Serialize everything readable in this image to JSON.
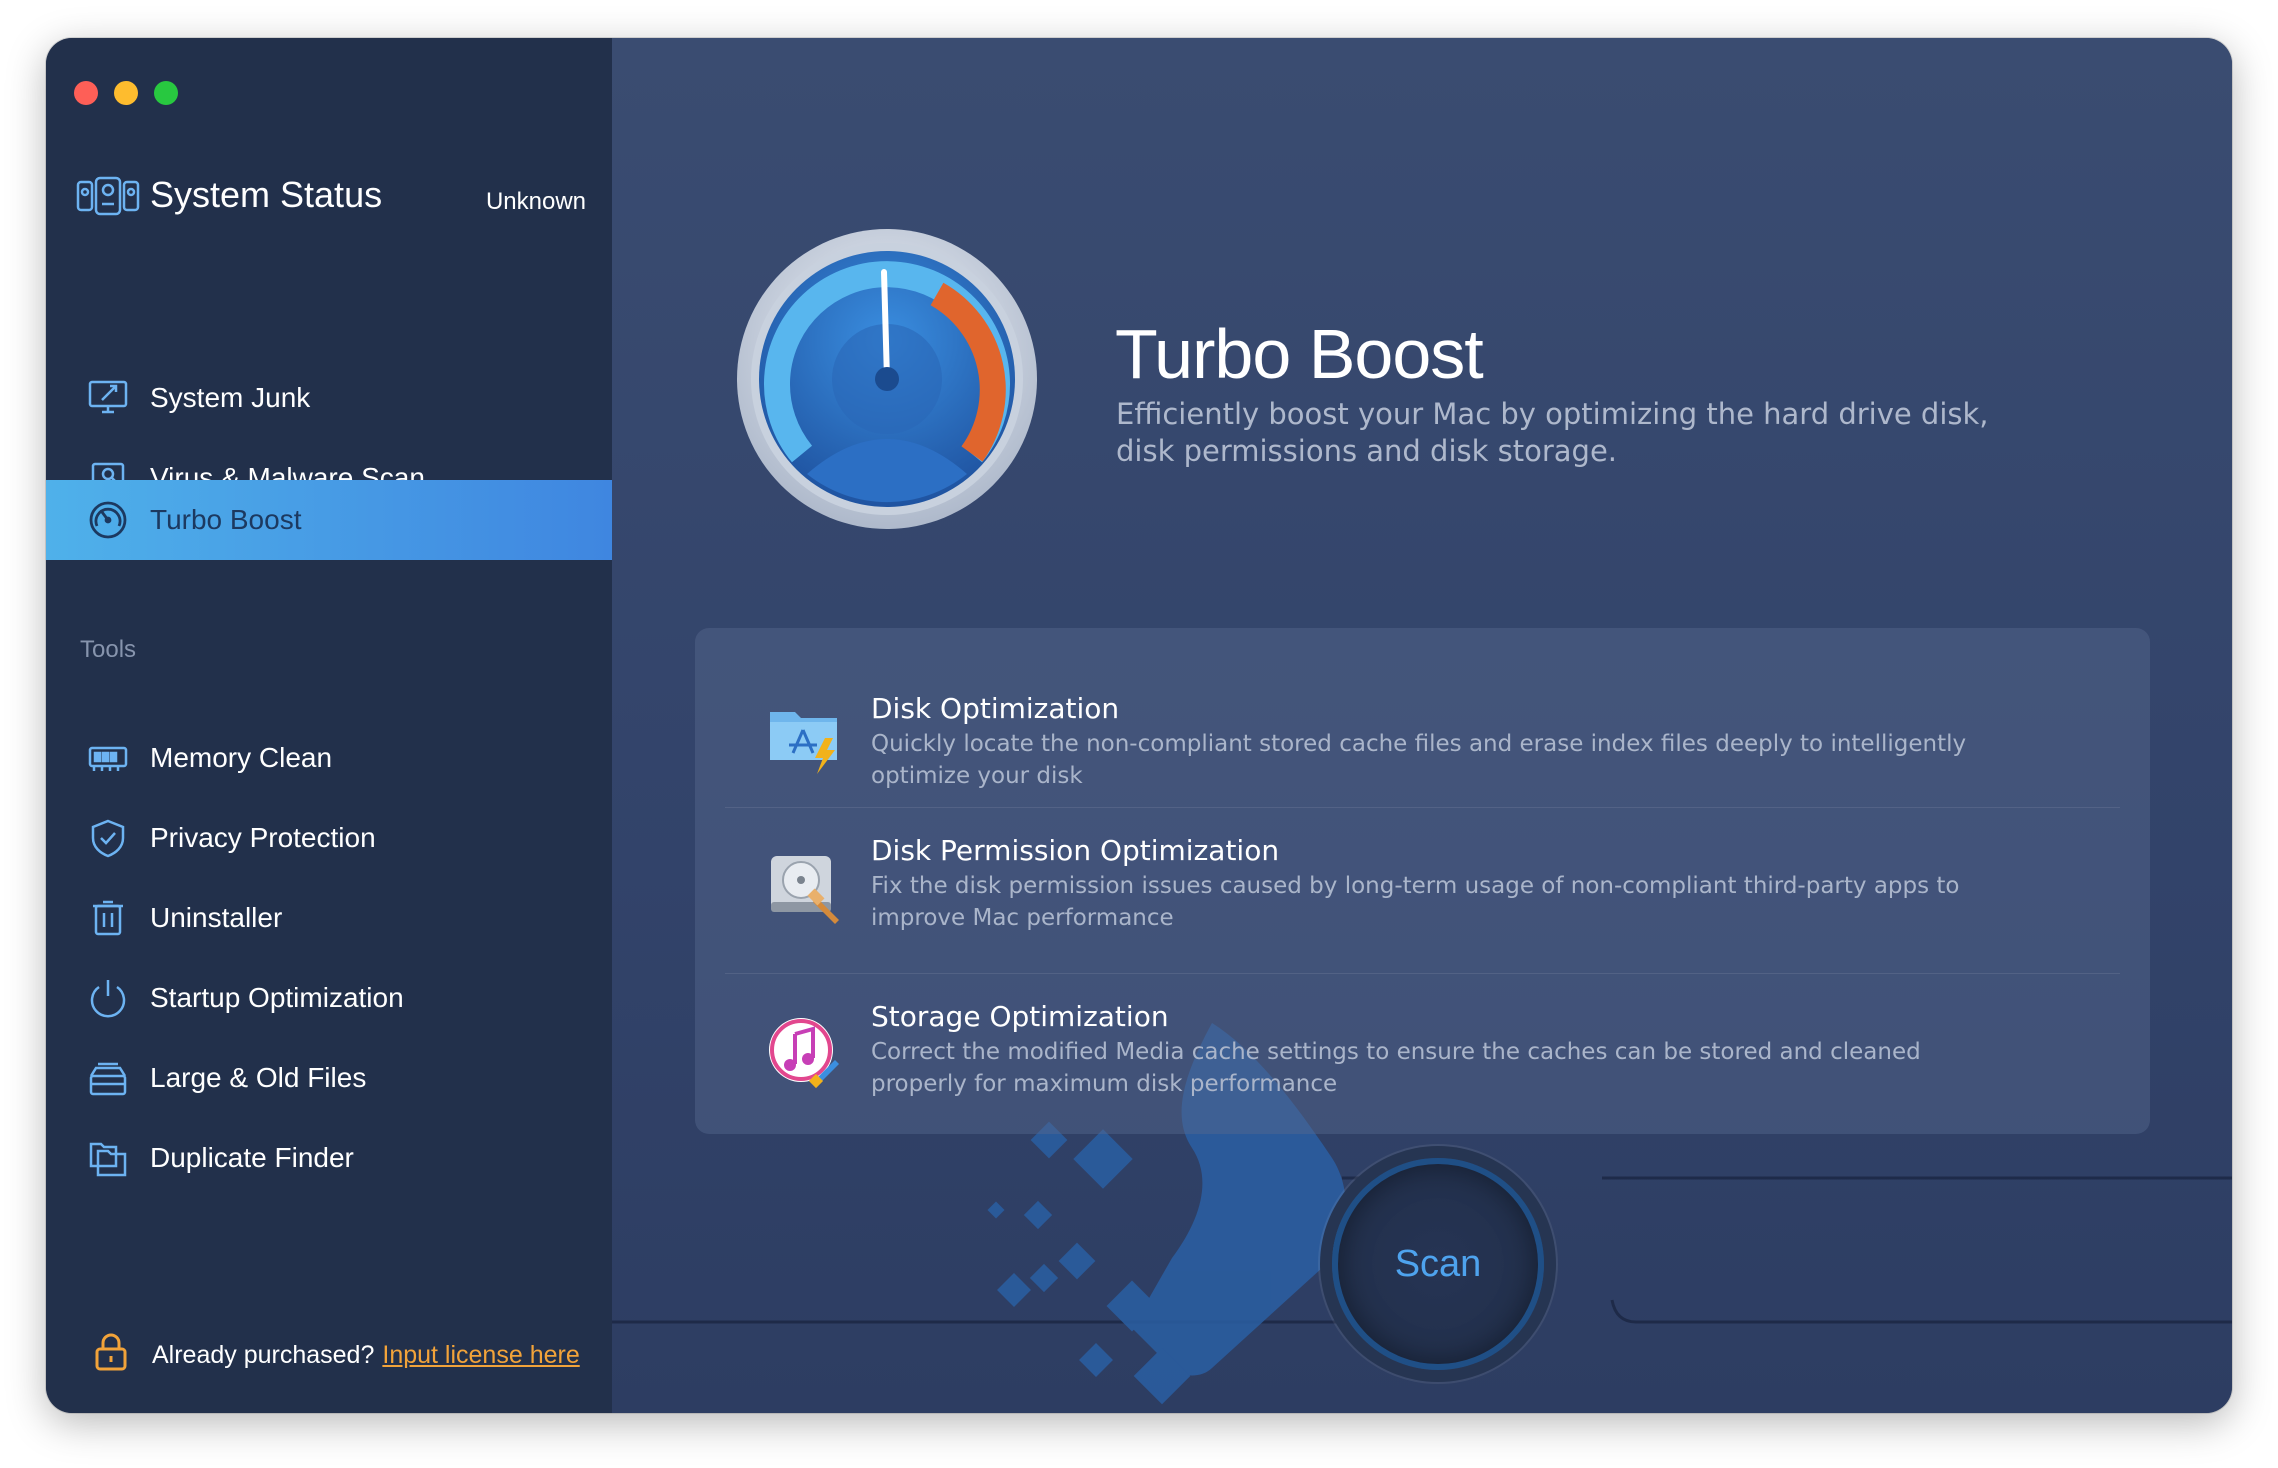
{
  "window": {
    "traffic_lights": [
      "close",
      "minimize",
      "zoom"
    ]
  },
  "sidebar": {
    "status": {
      "title": "System Status",
      "value": "Unknown",
      "icon": "system-status-icon"
    },
    "items": [
      {
        "label": "System Junk",
        "icon": "monitor-broom-icon",
        "active": false
      },
      {
        "label": "Virus & Malware Scan",
        "icon": "laptop-search-icon",
        "active": false
      },
      {
        "label": "Turbo Boost",
        "icon": "speedometer-icon",
        "active": true
      }
    ],
    "tools_title": "Tools",
    "tools": [
      {
        "label": "Memory Clean",
        "icon": "memory-chip-icon"
      },
      {
        "label": "Privacy Protection",
        "icon": "shield-check-icon"
      },
      {
        "label": "Uninstaller",
        "icon": "trash-icon"
      },
      {
        "label": "Startup Optimization",
        "icon": "power-icon"
      },
      {
        "label": "Large & Old Files",
        "icon": "file-drawer-icon"
      },
      {
        "label": "Duplicate Finder",
        "icon": "duplicate-folder-icon"
      }
    ],
    "license": {
      "text": "Already purchased?",
      "link": "Input license here",
      "icon": "lock-icon"
    }
  },
  "main": {
    "title": "Turbo Boost",
    "description": "Efficiently boost your Mac by optimizing the hard drive disk, disk permissions and disk storage.",
    "features": [
      {
        "title": "Disk Optimization",
        "desc": "Quickly locate the non-compliant stored cache files and erase index files deeply to intelligently optimize your disk",
        "icon": "app-folder-icon"
      },
      {
        "title": "Disk Permission Optimization",
        "desc": "Fix the disk permission issues caused by long-term usage of non-compliant third-party apps to improve Mac performance",
        "icon": "hard-drive-icon"
      },
      {
        "title": "Storage Optimization",
        "desc": "Correct the modified Media cache settings to ensure the caches can be stored and cleaned properly for maximum disk performance",
        "icon": "music-icon"
      }
    ],
    "scan_label": "Scan"
  },
  "colors": {
    "sidebar_bg": "#22304b",
    "main_bg": "#34466a",
    "active_item": "#4fb1ea",
    "link": "#f2a33a",
    "scan_text": "#4ea3ee"
  }
}
